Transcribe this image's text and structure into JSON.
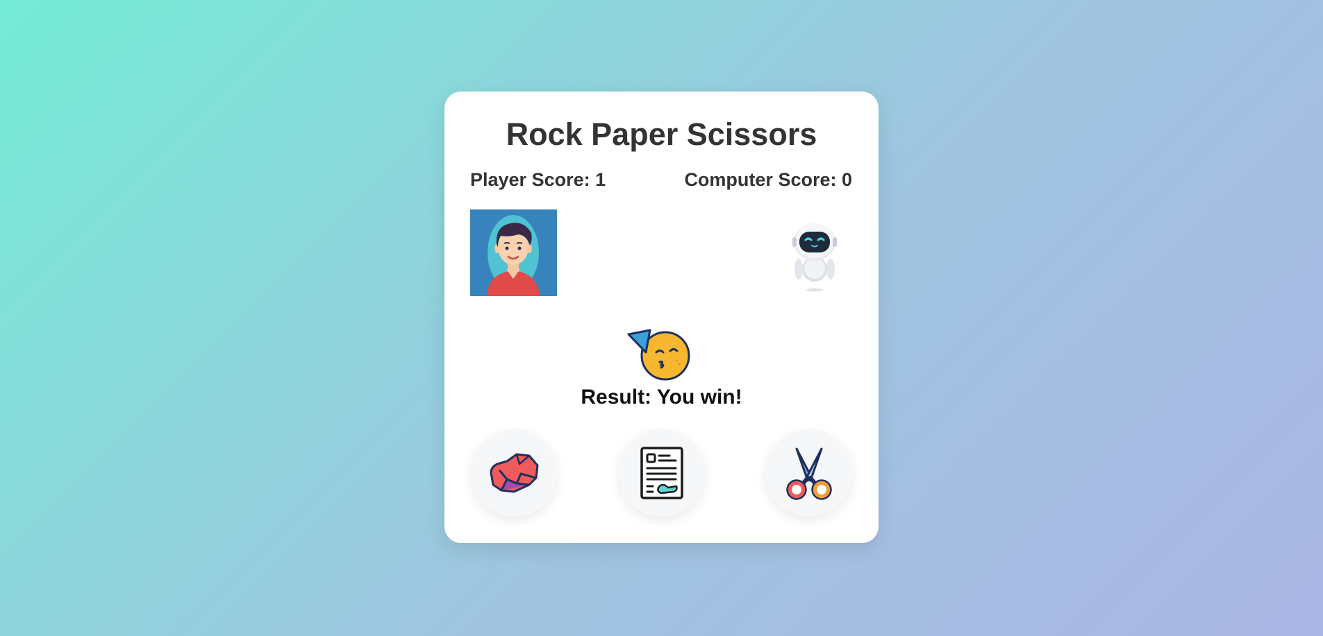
{
  "game": {
    "title": "Rock Paper Scissors",
    "player_score_label": "Player Score: 1",
    "computer_score_label": "Computer Score: 0",
    "result_label": "Result: You win!"
  },
  "avatars": {
    "player_icon": "person-avatar-icon",
    "computer_icon": "robot-icon",
    "result_icon": "party-emoji-icon"
  },
  "choices": [
    {
      "id": "rock",
      "icon": "rock-icon"
    },
    {
      "id": "paper",
      "icon": "paper-icon"
    },
    {
      "id": "scissors",
      "icon": "scissors-icon"
    }
  ],
  "colors": {
    "background_start": "#74ebd5",
    "background_end": "#acb6e5",
    "card": "#ffffff",
    "text": "#333333",
    "player_avatar_bg": "#3784bc"
  }
}
